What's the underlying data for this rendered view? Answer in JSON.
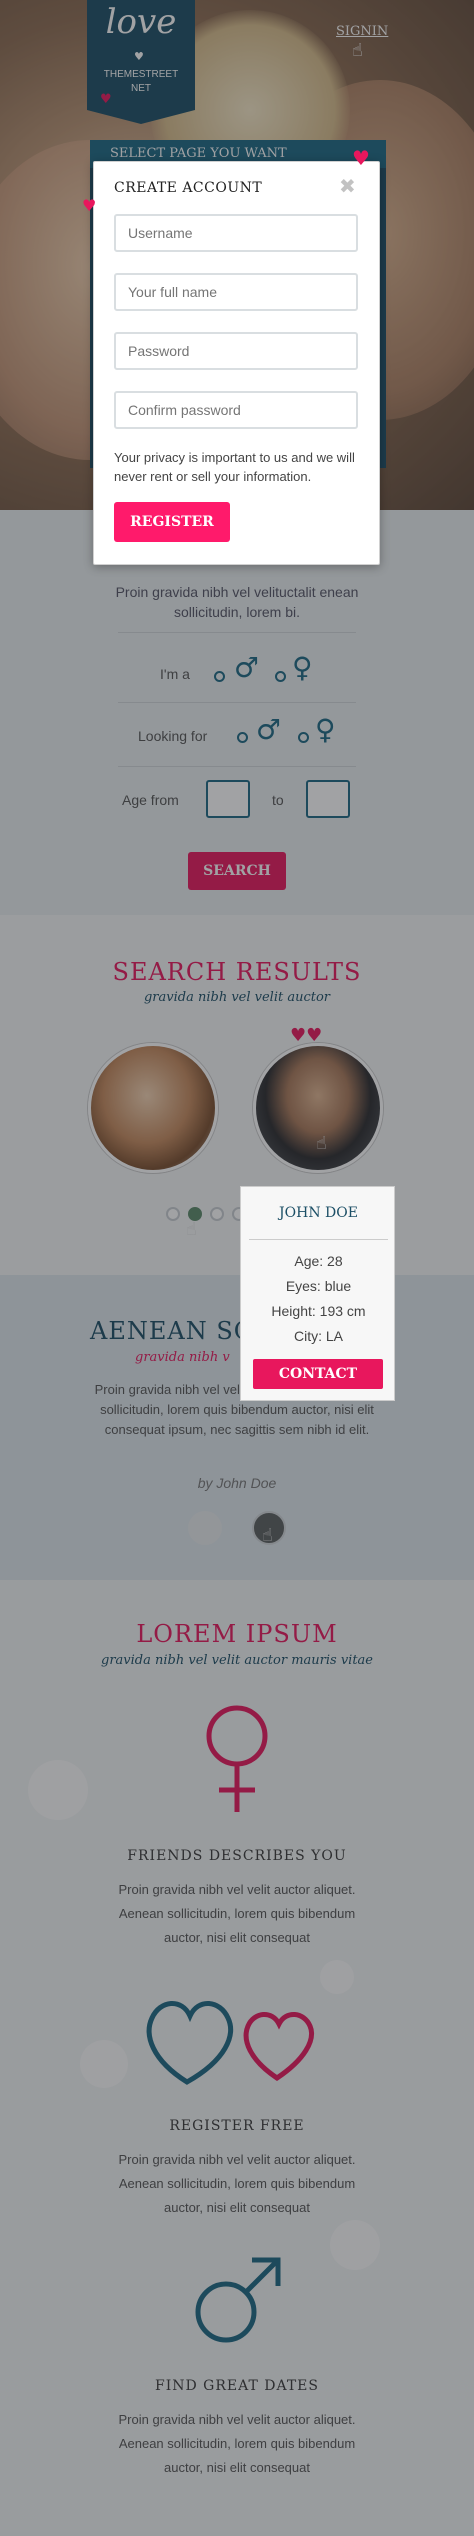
{
  "header": {
    "logo_script": "love",
    "logo_sub": "THEMESTREET\nNET",
    "signin_label": "SIGNIN",
    "page_select": "SELECT PAGE YOU WANT"
  },
  "search": {
    "subtitle": "Proin gravida nibh vel velituctalit enean sollicitudin, lorem bi.",
    "im_a_label": "I'm a",
    "looking_for_label": "Looking for",
    "age_from_label": "Age from",
    "age_to_label": "to",
    "age_from_value": "",
    "age_to_value": "",
    "search_label": "SEARCH"
  },
  "results": {
    "title": "SEARCH RESULTS",
    "subtitle": "gravida nibh vel velit auctor",
    "profile": {
      "name": "JOHN DOE",
      "age": "Age: 28",
      "eyes": "Eyes: blue",
      "height": "Height: 193 cm",
      "city": "City: LA",
      "contact_label": "CONTACT"
    }
  },
  "testimonial": {
    "title": "AENEAN SO",
    "subtitle": "gravida nibh v",
    "text": "Proin gravida nibh vel velit auctor aliquet. Aenean sollicitudin, lorem quis bibendum auctor, nisi elit consequat ipsum, nec sagittis sem nibh id elit.",
    "author": "by John Doe"
  },
  "features": {
    "title": "LOREM IPSUM",
    "subtitle": "gravida nibh vel velit auctor mauris vitae",
    "items": [
      {
        "title": "FRIENDS DESCRIBES YOU",
        "text": "Proin gravida nibh vel velit auctor aliquet. Aenean sollicitudin, lorem quis bibendum auctor, nisi elit consequat",
        "icon": "female-icon"
      },
      {
        "title": "REGISTER FREE",
        "text": "Proin gravida nibh vel velit auctor aliquet. Aenean sollicitudin, lorem quis bibendum auctor, nisi elit consequat",
        "icon": "hearts-icon"
      },
      {
        "title": "FIND GREAT DATES",
        "text": "Proin gravida nibh vel velit auctor aliquet. Aenean sollicitudin, lorem quis bibendum auctor, nisi elit consequat",
        "icon": "male-icon"
      }
    ]
  },
  "modal": {
    "title": "CREATE ACCOUNT",
    "username_placeholder": "Username",
    "fullname_placeholder": "Your full name",
    "password_placeholder": "Password",
    "confirm_placeholder": "Confirm password",
    "privacy_note": "Your privacy is important to us and we will never rent or sell your information.",
    "register_label": "REGISTER"
  },
  "colors": {
    "brand_pink": "#e8175d",
    "brand_blue": "#1c4f66",
    "accent_blue": "#1c6883"
  }
}
